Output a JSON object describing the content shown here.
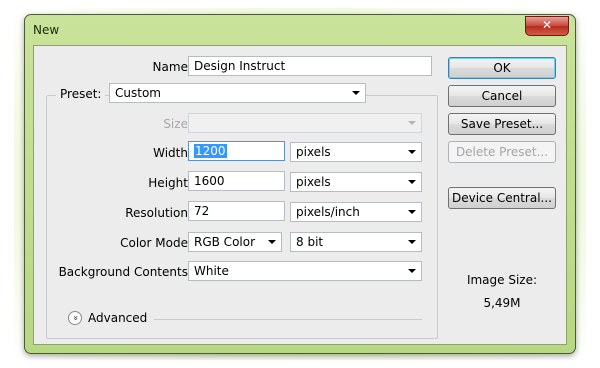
{
  "window": {
    "title": "New",
    "close_glyph": "✕"
  },
  "fields": {
    "name": {
      "label": "Name:",
      "value": "Design Instruct"
    },
    "preset": {
      "label": "Preset:",
      "value": "Custom"
    },
    "size": {
      "label": "Size:",
      "value": ""
    },
    "width": {
      "label": "Width:",
      "value": "1200",
      "unit": "pixels"
    },
    "height": {
      "label": "Height:",
      "value": "1600",
      "unit": "pixels"
    },
    "resolution": {
      "label": "Resolution:",
      "value": "72",
      "unit": "pixels/inch"
    },
    "color_mode": {
      "label": "Color Mode:",
      "value": "RGB Color",
      "depth": "8 bit"
    },
    "background": {
      "label": "Background Contents:",
      "value": "White"
    }
  },
  "advanced": {
    "label": "Advanced",
    "icon": "chevron-double-down-icon",
    "glyph": "»"
  },
  "buttons": {
    "ok": "OK",
    "cancel": "Cancel",
    "save_preset": "Save Preset...",
    "delete_preset": "Delete Preset...",
    "device_central": "Device Central..."
  },
  "image_size": {
    "label": "Image Size:",
    "value": "5,49M"
  }
}
